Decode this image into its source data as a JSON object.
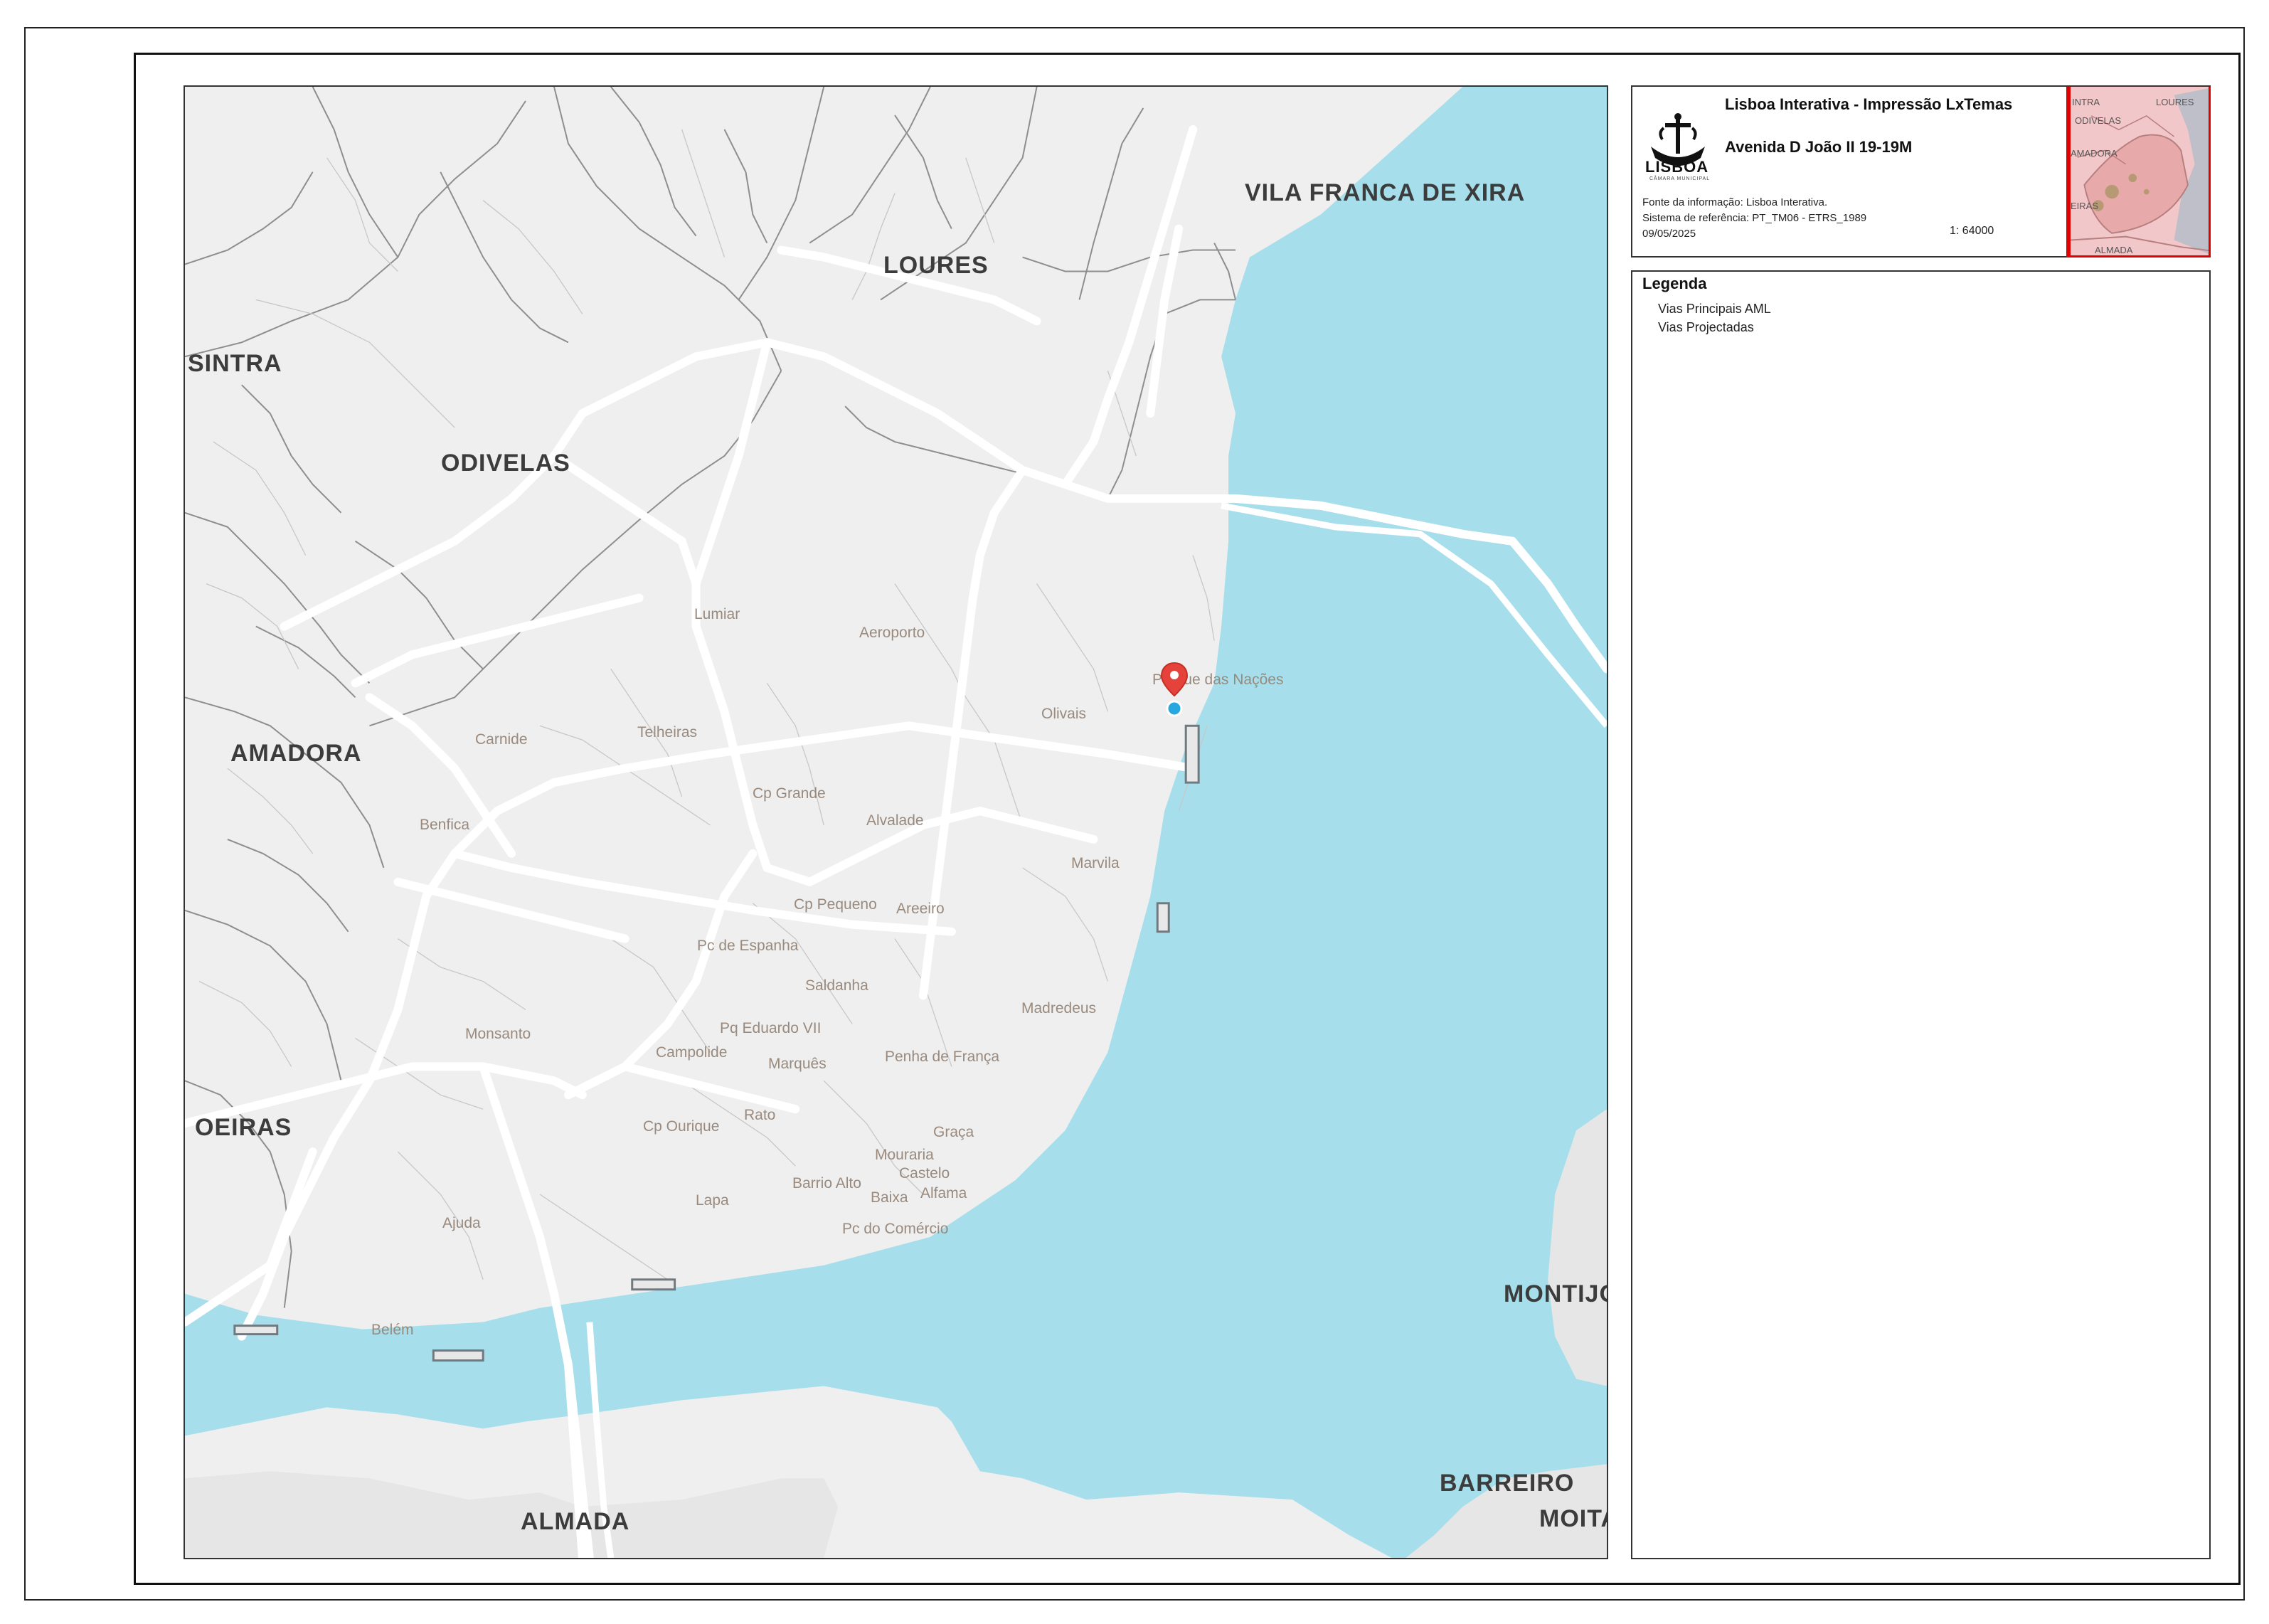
{
  "header": {
    "title": "Lisboa Interativa - Impressão LxTemas",
    "subtitle": "Avenida D João II 19-19M",
    "logo_text": "LISBOA",
    "logo_subtext": "CÂMARA MUNICIPAL",
    "info_source": "Fonte da informação: Lisboa Interativa.",
    "info_crs": "Sistema de referência: PT_TM06 - ETRS_1989",
    "info_date": "09/05/2025",
    "scale": "1:  64000"
  },
  "overview_map": {
    "labels": [
      "INTRA",
      "LOURES",
      "ODIVELAS",
      "AMADORA",
      "EIRAS",
      "ALMADA"
    ]
  },
  "legend": {
    "title": "Legenda",
    "items": [
      "Vias Principais AML",
      "Vias Projectadas"
    ]
  },
  "map": {
    "regions": {
      "vila_franca": "VILA FRANCA DE XIRA",
      "loures": "LOURES",
      "sintra": "SINTRA",
      "odivelas": "ODIVELAS",
      "amadora": "AMADORA",
      "oeiras": "OEIRAS",
      "montijo": "MONTIJO",
      "barreiro": "BARREIRO",
      "moita": "MOITA",
      "almada": "ALMADA"
    },
    "places": {
      "lumiar": "Lumiar",
      "aeroporto": "Aeroporto",
      "parque_nacoes": "Parque das Nações",
      "olivais": "Olivais",
      "carnide": "Carnide",
      "telheiras": "Telheiras",
      "cp_grande": "Cp Grande",
      "alvalade": "Alvalade",
      "benfica": "Benfica",
      "marvila": "Marvila",
      "cp_pequeno": "Cp Pequeno",
      "areeiro": "Areeiro",
      "pc_espanha": "Pc de Espanha",
      "saldanha": "Saldanha",
      "madredeus": "Madredeus",
      "monsanto": "Monsanto",
      "pq_eduardo": "Pq Eduardo VII",
      "campolide": "Campolide",
      "marques": "Marquês",
      "penha_franca": "Penha de França",
      "rato": "Rato",
      "cp_ourique": "Cp Ourique",
      "graca": "Graça",
      "mouraria": "Mouraria",
      "castelo": "Castelo",
      "barrio_alto": "Barrio Alto",
      "baixa": "Baixa",
      "alfama": "Alfama",
      "lapa": "Lapa",
      "ajuda": "Ajuda",
      "pc_comercio": "Pc do Comércio",
      "belem": "Belém"
    },
    "colors": {
      "land": "#efefef",
      "water": "#a6dfeb",
      "roads": "#ffffff",
      "boundaries": "#8e8e8e",
      "marker": "#e5423b",
      "location_dot": "#29a8e0"
    },
    "icons": [
      "location-marker-icon",
      "location-dot-icon"
    ]
  }
}
